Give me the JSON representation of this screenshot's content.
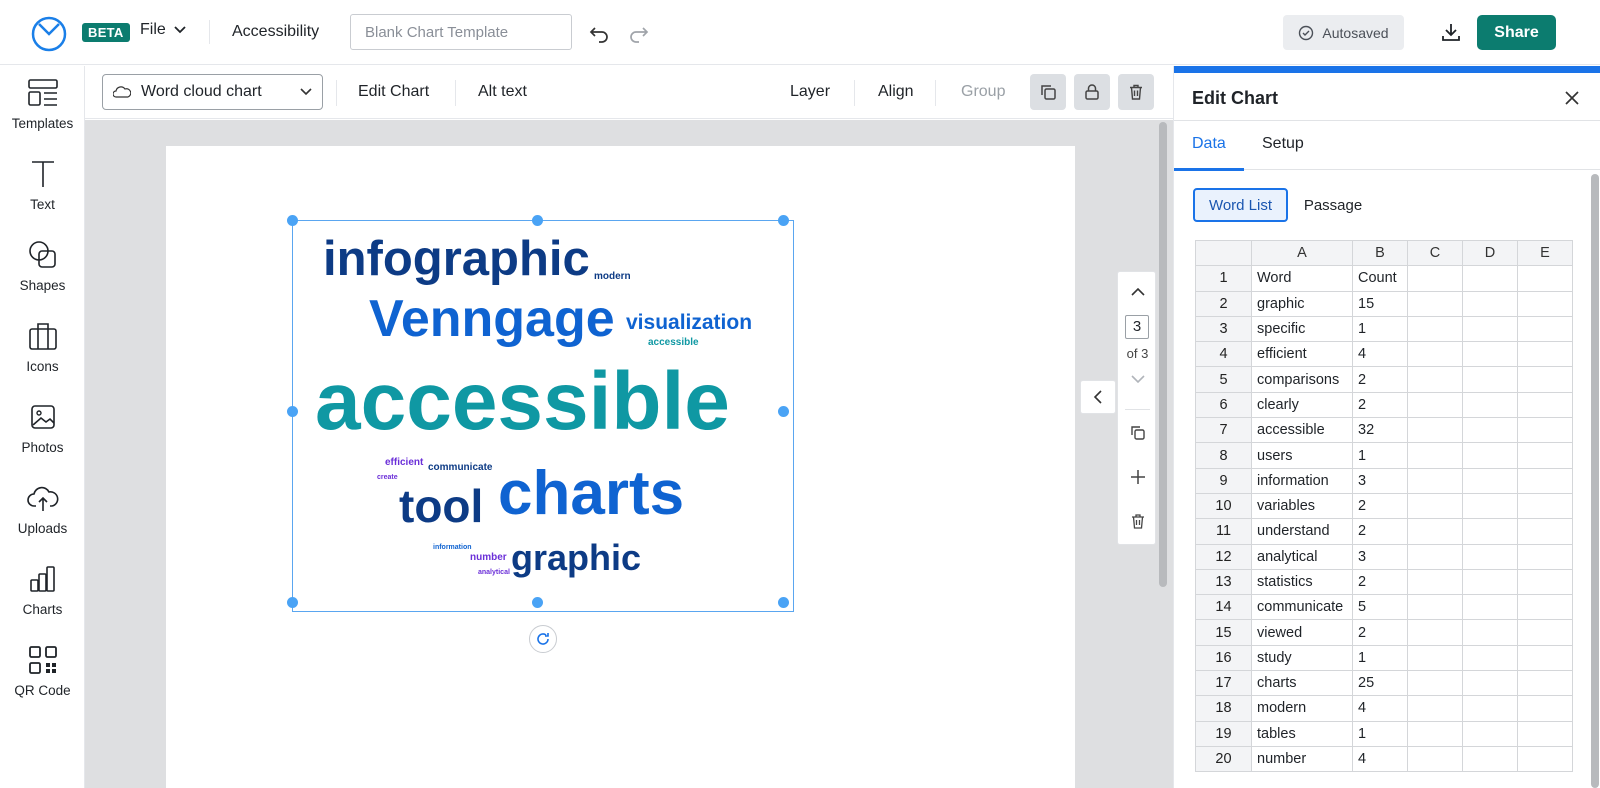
{
  "topbar": {
    "beta": "BETA",
    "file": "File",
    "accessibility": "Accessibility",
    "title_placeholder": "Blank Chart Template",
    "autosaved": "Autosaved",
    "share": "Share"
  },
  "sidebar": {
    "items": [
      {
        "label": "Templates",
        "icon": "templates-icon"
      },
      {
        "label": "Text",
        "icon": "text-icon"
      },
      {
        "label": "Shapes",
        "icon": "shapes-icon"
      },
      {
        "label": "Icons",
        "icon": "briefcase-icon"
      },
      {
        "label": "Photos",
        "icon": "image-icon"
      },
      {
        "label": "Uploads",
        "icon": "upload-cloud-icon"
      },
      {
        "label": "Charts",
        "icon": "bar-chart-icon"
      },
      {
        "label": "QR Code",
        "icon": "qr-code-icon"
      }
    ]
  },
  "toolbar": {
    "chart_type": "Word cloud chart",
    "edit_chart": "Edit Chart",
    "alt_text": "Alt text",
    "layer": "Layer",
    "align": "Align",
    "group": "Group"
  },
  "pagenav": {
    "current": "3",
    "of": "of 3"
  },
  "wordcloud": {
    "colors": {
      "navy": "#0d3b85",
      "blue": "#0f63d1",
      "teal": "#0f98a3",
      "purple": "#6b2fd8"
    },
    "words": [
      {
        "text": "infographic",
        "color": "navy"
      },
      {
        "text": "modern",
        "color": "navy"
      },
      {
        "text": "Venngage",
        "color": "blue"
      },
      {
        "text": "visualization",
        "color": "blue"
      },
      {
        "text": "accessible",
        "color": "teal"
      },
      {
        "text": "accessible",
        "color": "teal"
      },
      {
        "text": "efficient",
        "color": "purple"
      },
      {
        "text": "communicate",
        "color": "navy"
      },
      {
        "text": "create",
        "color": "purple"
      },
      {
        "text": "tool",
        "color": "navy"
      },
      {
        "text": "charts",
        "color": "blue"
      },
      {
        "text": "information",
        "color": "blue"
      },
      {
        "text": "number",
        "color": "purple"
      },
      {
        "text": "analytical",
        "color": "purple"
      },
      {
        "text": "graphic",
        "color": "navy"
      },
      {
        "text": "statistics",
        "color": "blue"
      },
      {
        "text": "clearly",
        "color": "navy"
      },
      {
        "text": "comparisons",
        "color": "blue"
      },
      {
        "text": "viewed",
        "color": "teal"
      },
      {
        "text": "understand",
        "color": "teal"
      },
      {
        "text": "variables",
        "color": "blue"
      }
    ]
  },
  "panel": {
    "title": "Edit Chart",
    "tabs": [
      "Data",
      "Setup"
    ],
    "modes": [
      "Word List",
      "Passage"
    ],
    "columns": [
      "A",
      "B",
      "C",
      "D",
      "E"
    ],
    "rows": [
      [
        "1",
        "Word",
        "Count"
      ],
      [
        "2",
        "graphic",
        "15"
      ],
      [
        "3",
        "specific",
        "1"
      ],
      [
        "4",
        "efficient",
        "4"
      ],
      [
        "5",
        "comparisons",
        "2"
      ],
      [
        "6",
        "clearly",
        "2"
      ],
      [
        "7",
        "accessible",
        "32"
      ],
      [
        "8",
        "users",
        "1"
      ],
      [
        "9",
        "information",
        "3"
      ],
      [
        "10",
        "variables",
        "2"
      ],
      [
        "11",
        "understand",
        "2"
      ],
      [
        "12",
        "analytical",
        "3"
      ],
      [
        "13",
        "statistics",
        "2"
      ],
      [
        "14",
        "communicate",
        "5"
      ],
      [
        "15",
        "viewed",
        "2"
      ],
      [
        "16",
        "study",
        "1"
      ],
      [
        "17",
        "charts",
        "25"
      ],
      [
        "18",
        "modern",
        "4"
      ],
      [
        "19",
        "tables",
        "1"
      ],
      [
        "20",
        "number",
        "4"
      ]
    ]
  }
}
